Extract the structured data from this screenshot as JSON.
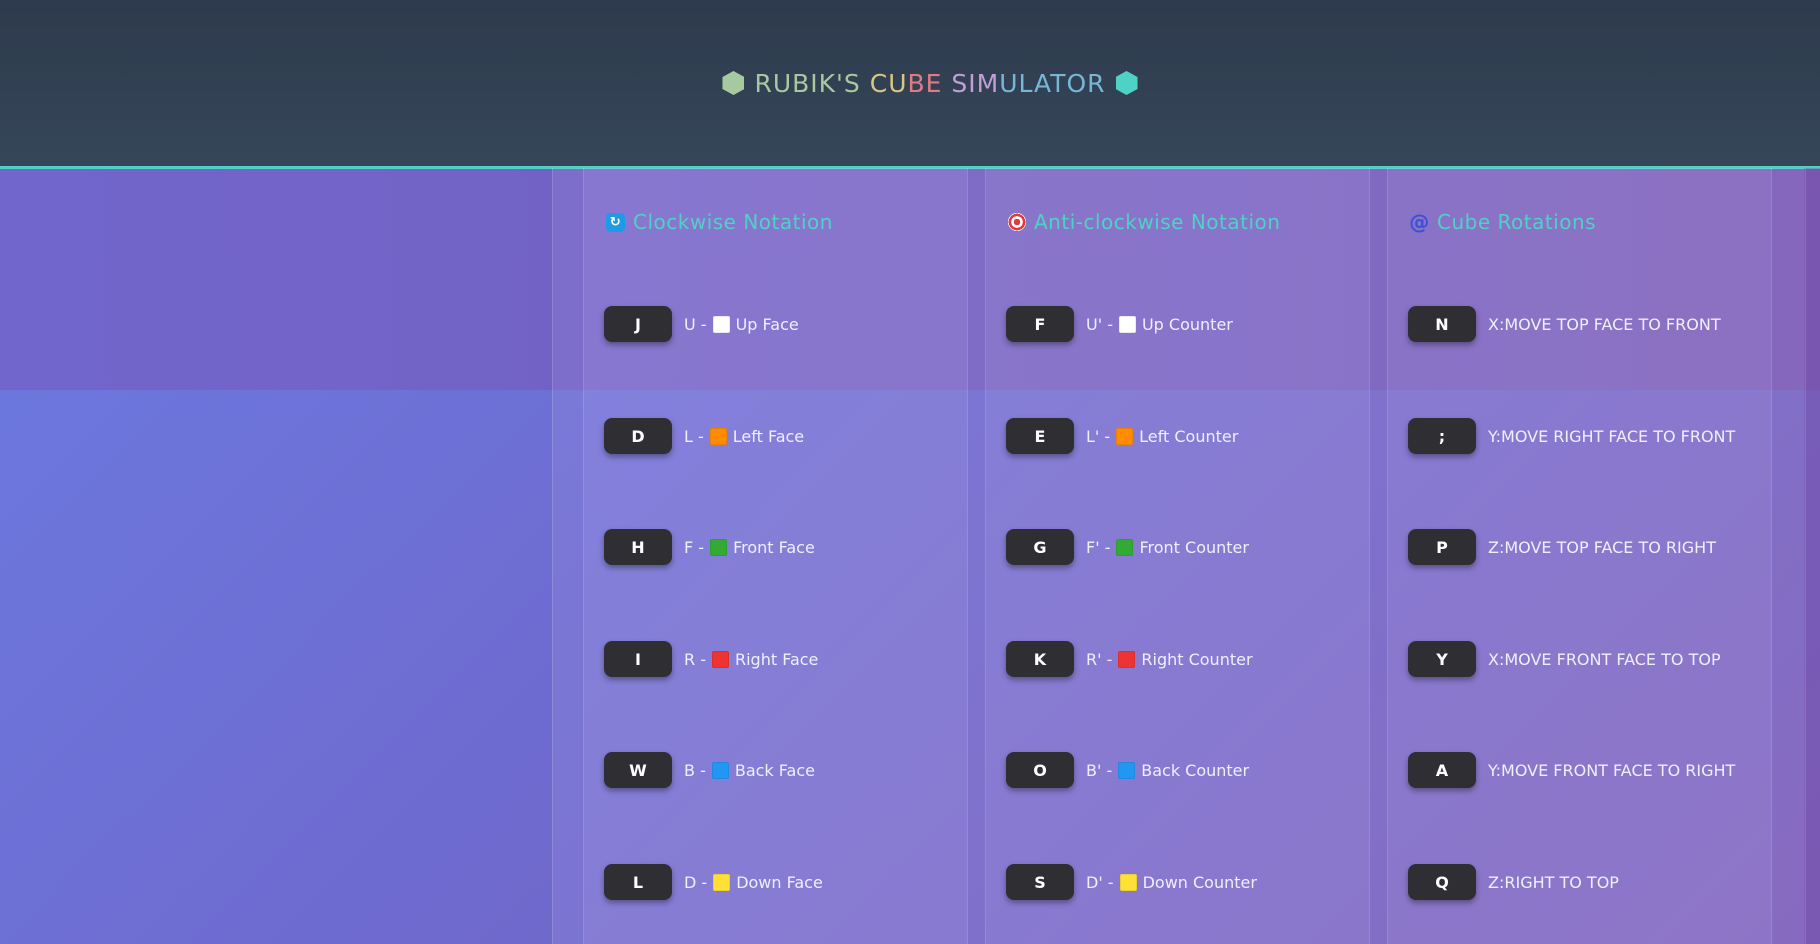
{
  "header": {
    "title_parts": [
      "RUBIK'S ",
      "CU",
      "BE ",
      "SIM",
      "ULATOR"
    ],
    "left_icon": "hexagon-icon",
    "right_icon": "hexagon-icon",
    "accent_color": "#4fd1c5"
  },
  "columns": [
    {
      "heading": "Clockwise Notation",
      "icon": "refresh-icon",
      "rows": [
        {
          "key": "J",
          "prefix": "U -",
          "color": "#ffffff",
          "label": "Up Face"
        },
        {
          "key": "D",
          "prefix": "L -",
          "color": "#ff8c00",
          "label": "Left Face"
        },
        {
          "key": "H",
          "prefix": "F -",
          "color": "#33aa33",
          "label": "Front Face"
        },
        {
          "key": "I",
          "prefix": "R -",
          "color": "#ee3333",
          "label": "Right Face"
        },
        {
          "key": "W",
          "prefix": "B -",
          "color": "#2196f3",
          "label": "Back Face"
        },
        {
          "key": "L",
          "prefix": "D -",
          "color": "#ffe135",
          "label": "Down Face"
        }
      ]
    },
    {
      "heading": "Anti-clockwise Notation",
      "icon": "target-icon",
      "rows": [
        {
          "key": "F",
          "prefix": "U' -",
          "color": "#ffffff",
          "label": "Up Counter"
        },
        {
          "key": "E",
          "prefix": "L' -",
          "color": "#ff8c00",
          "label": "Left Counter"
        },
        {
          "key": "G",
          "prefix": "F' -",
          "color": "#33aa33",
          "label": "Front Counter"
        },
        {
          "key": "K",
          "prefix": "R' -",
          "color": "#ee3333",
          "label": "Right Counter"
        },
        {
          "key": "O",
          "prefix": "B' -",
          "color": "#2196f3",
          "label": "Back Counter"
        },
        {
          "key": "S",
          "prefix": "D' -",
          "color": "#ffe135",
          "label": "Down Counter"
        }
      ]
    },
    {
      "heading": "Cube Rotations",
      "icon": "swirl-icon",
      "rows": [
        {
          "key": "N",
          "label": "X:MOVE TOP FACE TO FRONT"
        },
        {
          "key": ";",
          "label": "Y:MOVE RIGHT FACE TO FRONT"
        },
        {
          "key": "P",
          "label": "Z:MOVE TOP FACE TO RIGHT"
        },
        {
          "key": "Y",
          "label": "X:MOVE FRONT FACE TO TOP"
        },
        {
          "key": "A",
          "label": "Y:MOVE FRONT FACE TO RIGHT"
        },
        {
          "key": "Q",
          "label": "Z:RIGHT TO TOP"
        }
      ]
    }
  ]
}
